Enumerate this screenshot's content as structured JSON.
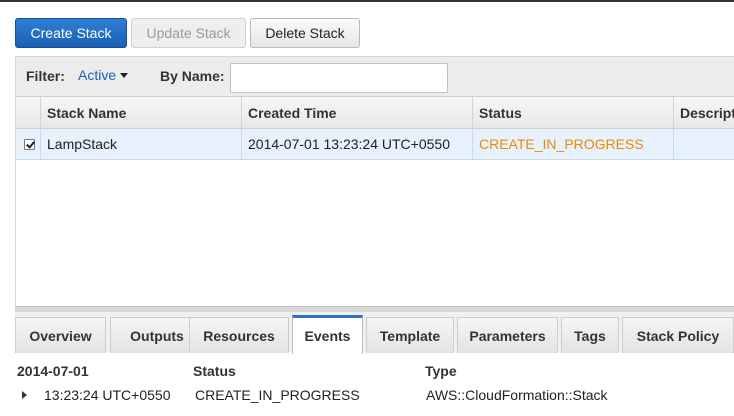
{
  "toolbar": {
    "create_label": "Create Stack",
    "update_label": "Update Stack",
    "delete_label": "Delete Stack"
  },
  "filter": {
    "label": "Filter:",
    "value": "Active",
    "by_name_label": "By Name:",
    "by_name_value": ""
  },
  "grid": {
    "columns": [
      "Stack Name",
      "Created Time",
      "Status",
      "Descript"
    ],
    "rows": [
      {
        "selected": true,
        "name": "LampStack",
        "created": "2014-07-01 13:23:24 UTC+0550",
        "status": "CREATE_IN_PROGRESS",
        "description": ""
      }
    ]
  },
  "tabs": [
    {
      "label": "Overview",
      "active": false
    },
    {
      "label": "Outputs",
      "active": false
    },
    {
      "label": "Resources",
      "active": false
    },
    {
      "label": "Events",
      "active": true
    },
    {
      "label": "Template",
      "active": false
    },
    {
      "label": "Parameters",
      "active": false
    },
    {
      "label": "Tags",
      "active": false
    },
    {
      "label": "Stack Policy",
      "active": false
    }
  ],
  "events": {
    "date_header": "2014-07-01",
    "status_header": "Status",
    "type_header": "Type",
    "rows": [
      {
        "time": "13:23:24 UTC+0550",
        "status": "CREATE_IN_PROGRESS",
        "type": "AWS::CloudFormation::Stack"
      }
    ]
  },
  "colors": {
    "primary_button": "#1a61b5",
    "status_in_progress": "#ef8a00",
    "link_blue": "#1f5fbb",
    "selected_row": "#e6f1fb",
    "active_tab_accent": "#2a73c6"
  }
}
